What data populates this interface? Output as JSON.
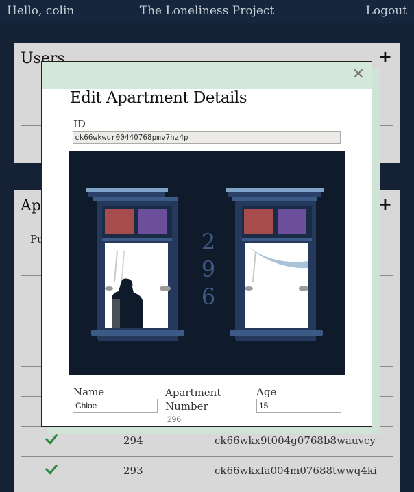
{
  "header": {
    "greeting": "Hello, colin",
    "title": "The Loneliness Project",
    "logout": "Logout"
  },
  "users_panel": {
    "title": "Users",
    "add_icon": "plus-icon"
  },
  "apartments_panel": {
    "title": "Apa",
    "sub": "Pu",
    "add_icon": "plus-icon",
    "rows": [
      {
        "check_icon": "check-icon",
        "number": "294",
        "id": "ck66wkx9t004g0768b8wauvcy"
      },
      {
        "check_icon": "check-icon",
        "number": "293",
        "id": "ck66wkxfa004m07688twwq4ki"
      }
    ]
  },
  "modal": {
    "title": "Edit Apartment Details",
    "close_icon": "close-icon",
    "id_label": "ID",
    "id_value": "ck66wkwur00440768pmv7hz4p",
    "illustration": {
      "number_digits": [
        "2",
        "9",
        "6"
      ],
      "colors": {
        "background": "#0f1a2b",
        "frame": "#2a4066",
        "frame_light": "#7fa3c8",
        "red_pane": "#a64c4c",
        "purple_pane": "#6b4f9a",
        "number": "#3e5a85"
      }
    },
    "name_label": "Name",
    "name_value": "Chloe",
    "apt_label": "Apartment Number",
    "apt_placeholder": "296",
    "age_label": "Age",
    "age_value": "15"
  },
  "colors": {
    "page_bg": "#152236",
    "modal_header": "#d3e8d9",
    "check_green": "#2e8b3e"
  }
}
